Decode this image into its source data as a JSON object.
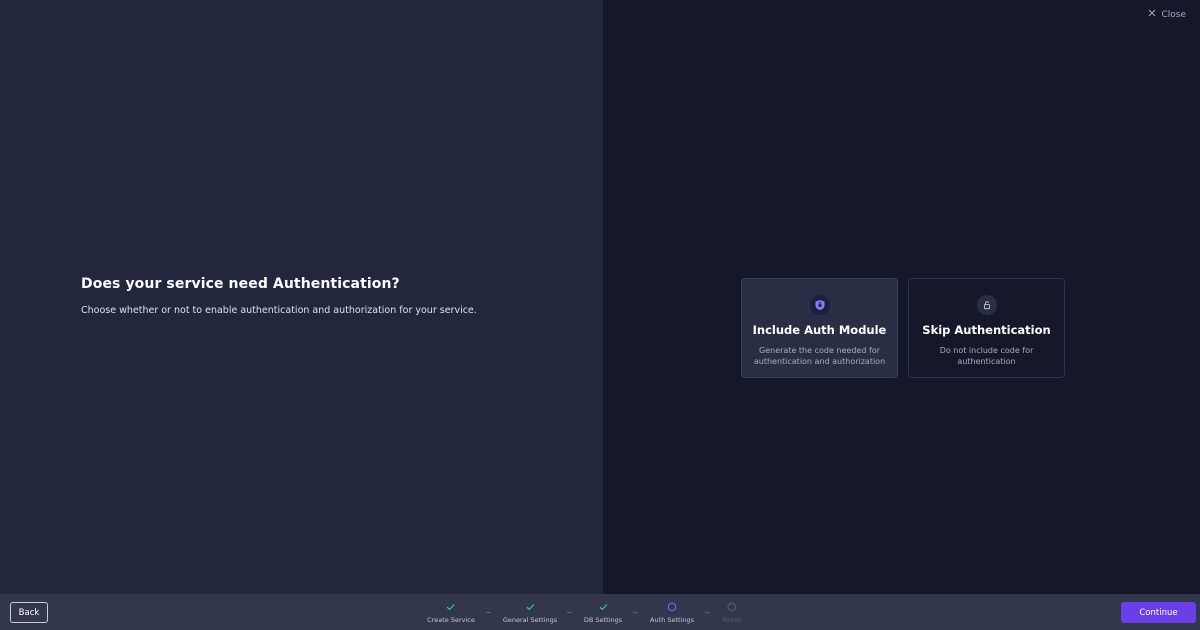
{
  "header": {
    "close_label": "Close"
  },
  "intro": {
    "title": "Does your service need Authentication?",
    "subtitle": "Choose whether or not to enable authentication and authorization for your service."
  },
  "options": [
    {
      "title": "Include Auth Module",
      "description": "Generate the code needed for authentication and authorization",
      "icon": "shield-icon",
      "selected": true
    },
    {
      "title": "Skip Authentication",
      "description": "Do not include code for authentication",
      "icon": "unlock-icon",
      "selected": false
    }
  ],
  "footer": {
    "back_label": "Back",
    "continue_label": "Continue",
    "steps": [
      {
        "label": "Create Service",
        "status": "complete"
      },
      {
        "label": "General Settings",
        "status": "complete"
      },
      {
        "label": "DB Settings",
        "status": "complete"
      },
      {
        "label": "Auth Settings",
        "status": "current"
      },
      {
        "label": "Finish",
        "status": "upcoming"
      }
    ]
  },
  "colors": {
    "accent": "#6c3ee8",
    "complete": "#3ec9a7",
    "current": "#7b6cf0"
  }
}
